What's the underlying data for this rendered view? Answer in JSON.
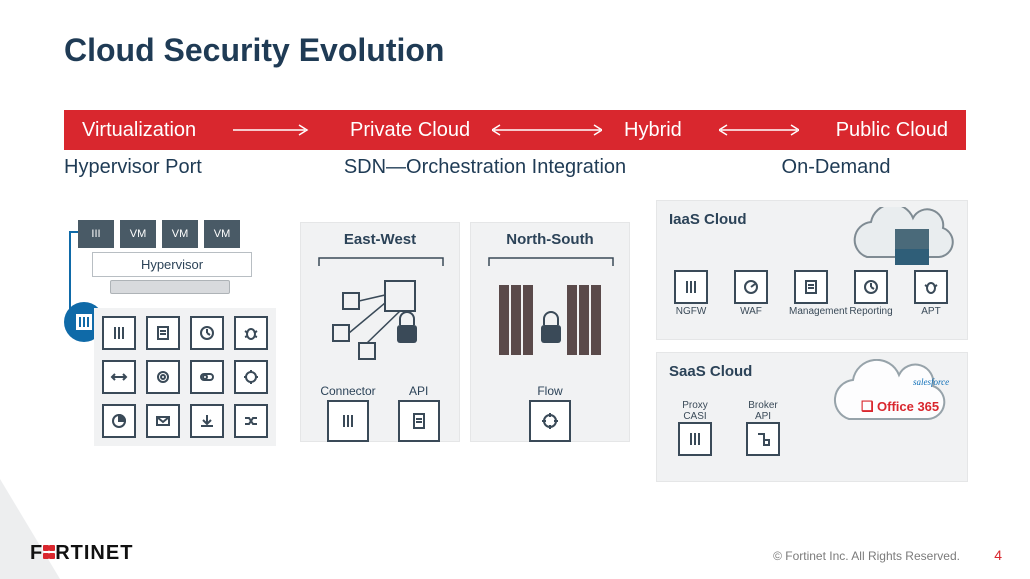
{
  "title": "Cloud Security Evolution",
  "stages": [
    "Virtualization",
    "Private Cloud",
    "Hybrid",
    "Public Cloud"
  ],
  "stage_subtitles": [
    "Hypervisor Port",
    "SDN—Orchestration Integration",
    "On-Demand"
  ],
  "hypervisor": {
    "vms": [
      "III",
      "VM",
      "VM",
      "VM"
    ],
    "label": "Hypervisor",
    "grid_icons": [
      "bars-icon",
      "clipboard-icon",
      "clock-icon",
      "bug-icon",
      "arrows-h-icon",
      "gear-icon",
      "toggle-icon",
      "cog-icon",
      "pie-icon",
      "envelope-icon",
      "download-icon",
      "shuffle-icon"
    ]
  },
  "sdn": {
    "east_west": {
      "heading": "East-West",
      "connector_label": "Connector",
      "api_label": "API"
    },
    "north_south": {
      "heading": "North-South",
      "flow_label": "Flow"
    }
  },
  "iaas": {
    "heading": "IaaS Cloud",
    "items": [
      {
        "label": "NGFW",
        "icon": "bars-icon"
      },
      {
        "label": "WAF",
        "icon": "gauge-icon"
      },
      {
        "label": "Management",
        "icon": "clipboard-icon"
      },
      {
        "label": "Reporting",
        "icon": "clock-icon"
      },
      {
        "label": "APT",
        "icon": "bug-icon"
      }
    ]
  },
  "saas": {
    "heading": "SaaS Cloud",
    "items": [
      {
        "label": "Proxy\nCASI",
        "icon": "bars-icon"
      },
      {
        "label": "Broker\nAPI",
        "icon": "flow-icon"
      }
    ],
    "cloud_brands": [
      "salesforce",
      "Office 365"
    ]
  },
  "footer": {
    "brand": "F::RTINET",
    "copyright": "© Fortinet Inc. All Rights Reserved.",
    "page": "4"
  }
}
